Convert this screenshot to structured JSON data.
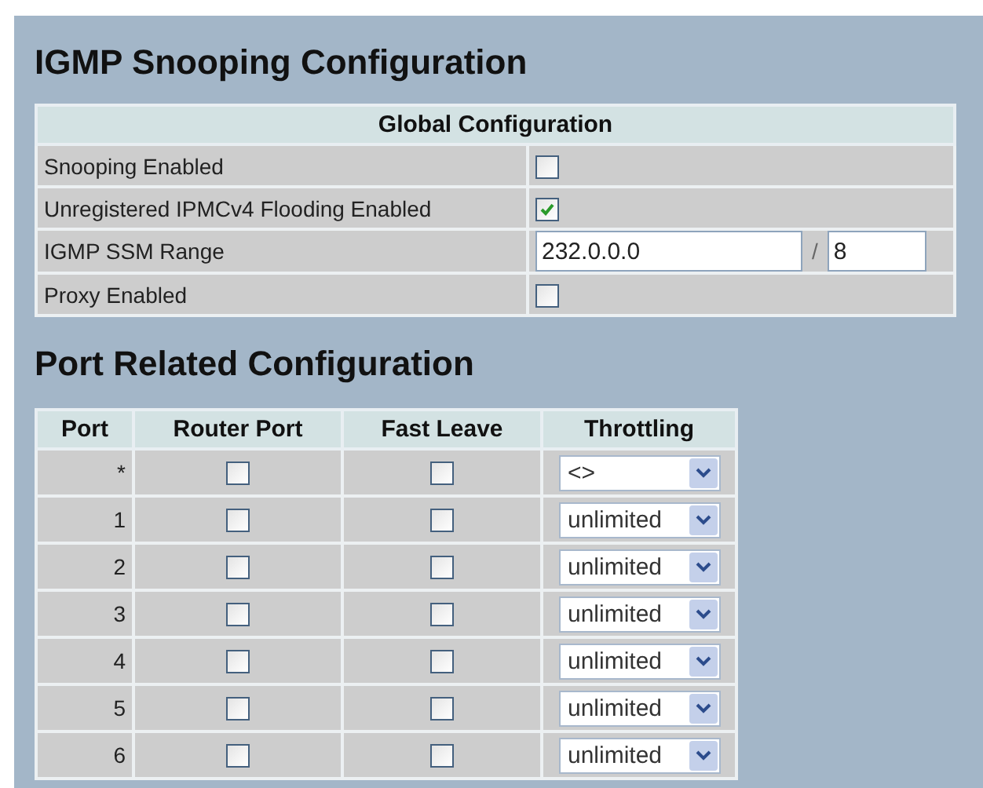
{
  "title": "IGMP Snooping Configuration",
  "global": {
    "heading": "Global Configuration",
    "rows": [
      {
        "kind": "checkbox",
        "label": "Snooping Enabled",
        "checked": false
      },
      {
        "kind": "checkbox",
        "label": "Unregistered IPMCv4 Flooding Enabled",
        "checked": true
      },
      {
        "kind": "range",
        "label": "IGMP SSM Range",
        "address": "232.0.0.0",
        "separator": "/",
        "prefix": "8"
      },
      {
        "kind": "checkbox",
        "label": "Proxy Enabled",
        "checked": false
      }
    ]
  },
  "port_title": "Port Related Configuration",
  "port_table": {
    "columns": [
      "Port",
      "Router Port",
      "Fast Leave",
      "Throttling"
    ],
    "rows": [
      {
        "port": "*",
        "router_port": false,
        "fast_leave": false,
        "throttling": "<>"
      },
      {
        "port": "1",
        "router_port": false,
        "fast_leave": false,
        "throttling": "unlimited"
      },
      {
        "port": "2",
        "router_port": false,
        "fast_leave": false,
        "throttling": "unlimited"
      },
      {
        "port": "3",
        "router_port": false,
        "fast_leave": false,
        "throttling": "unlimited"
      },
      {
        "port": "4",
        "router_port": false,
        "fast_leave": false,
        "throttling": "unlimited"
      },
      {
        "port": "5",
        "router_port": false,
        "fast_leave": false,
        "throttling": "unlimited"
      },
      {
        "port": "6",
        "router_port": false,
        "fast_leave": false,
        "throttling": "unlimited"
      }
    ]
  }
}
